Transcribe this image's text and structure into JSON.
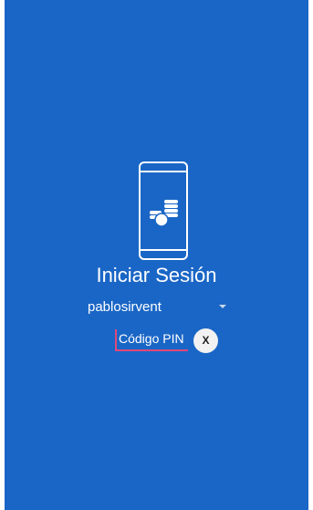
{
  "login": {
    "title": "Iniciar Sesión",
    "username": "pablosirvent",
    "pin_placeholder": "Código PIN",
    "clear_label": "X"
  },
  "icons": {
    "logo": "phone-coins-icon",
    "dropdown": "chevron-down-icon"
  },
  "colors": {
    "background": "#1a66c6",
    "accent": "#e0487a",
    "text": "#ffffff"
  }
}
